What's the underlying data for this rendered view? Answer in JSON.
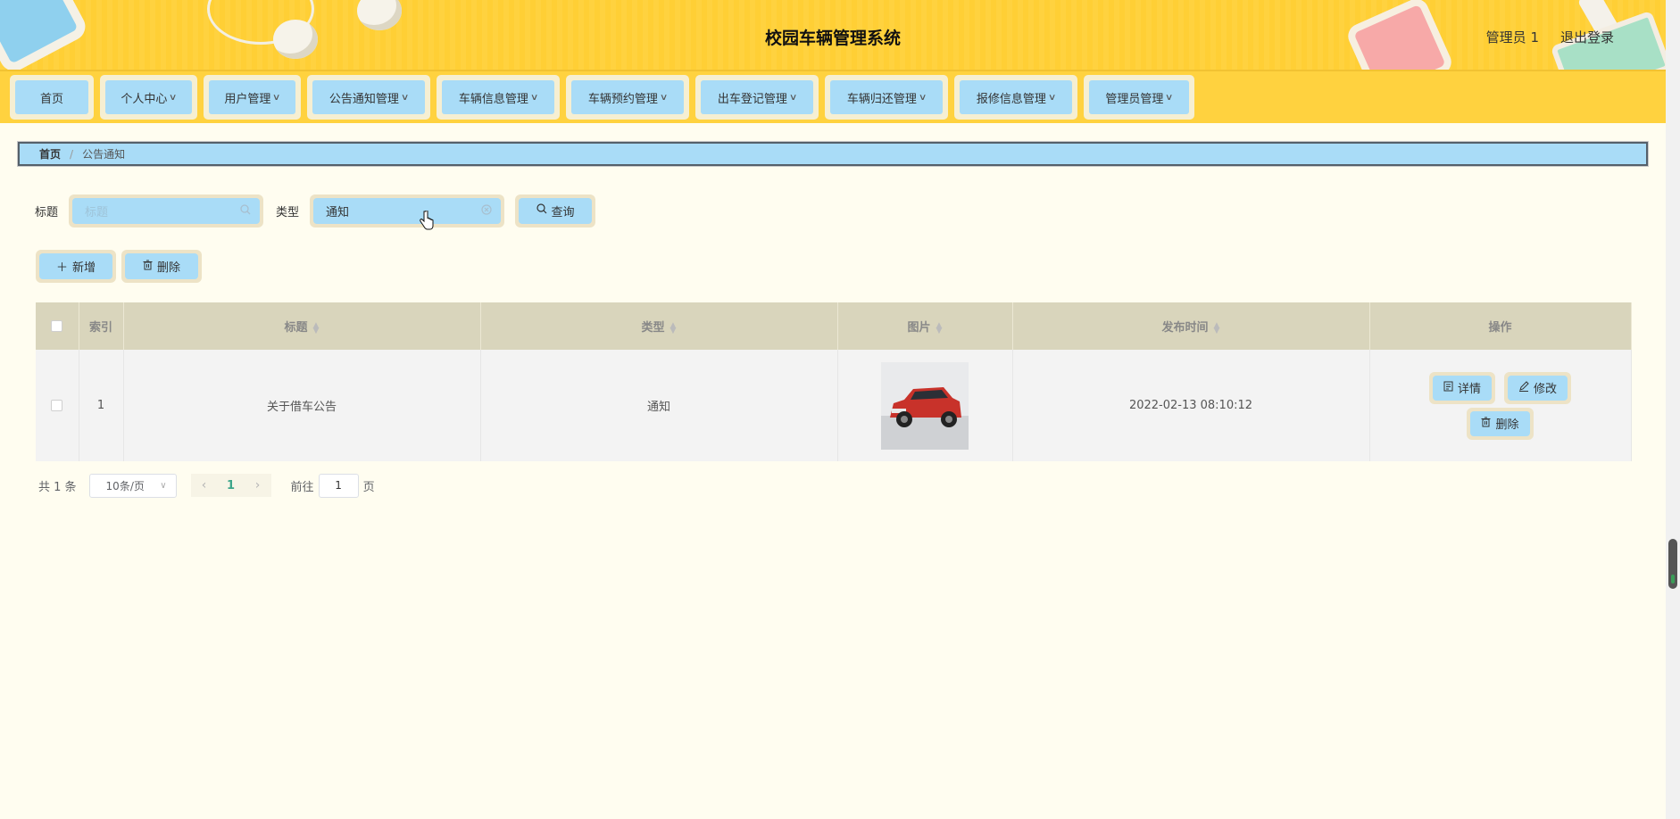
{
  "header": {
    "title": "校园车辆管理系统",
    "user": "管理员 1",
    "logout": "退出登录"
  },
  "nav": [
    {
      "label": "首页",
      "dropdown": false
    },
    {
      "label": "个人中心",
      "dropdown": true
    },
    {
      "label": "用户管理",
      "dropdown": true
    },
    {
      "label": "公告通知管理",
      "dropdown": true
    },
    {
      "label": "车辆信息管理",
      "dropdown": true
    },
    {
      "label": "车辆预约管理",
      "dropdown": true
    },
    {
      "label": "出车登记管理",
      "dropdown": true
    },
    {
      "label": "车辆归还管理",
      "dropdown": true
    },
    {
      "label": "报修信息管理",
      "dropdown": true
    },
    {
      "label": "管理员管理",
      "dropdown": true
    }
  ],
  "breadcrumb": {
    "home": "首页",
    "separator": "/",
    "current": "公告通知"
  },
  "search": {
    "title_label": "标题",
    "title_placeholder": "标题",
    "type_label": "类型",
    "type_value": "通知",
    "query_button": "查询"
  },
  "actions": {
    "add": "新增",
    "delete": "删除"
  },
  "table": {
    "columns": [
      "索引",
      "标题",
      "类型",
      "图片",
      "发布时间",
      "操作"
    ],
    "rows": [
      {
        "index": "1",
        "title": "关于借车公告",
        "type": "通知",
        "image": "red-suv-car",
        "time": "2022-02-13 08:10:12",
        "ops": {
          "detail": "详情",
          "edit": "修改",
          "delete": "删除"
        }
      }
    ]
  },
  "pagination": {
    "total": "共 1 条",
    "page_size": "10条/页",
    "current_page": "1",
    "goto_label": "前往",
    "goto_value": "1",
    "page_suffix": "页"
  },
  "colors": {
    "header_bg": "#ffd23f",
    "button_bg": "#a9dcf7",
    "page_bg": "#fffdf0",
    "table_header_bg": "#d9d5bc"
  }
}
